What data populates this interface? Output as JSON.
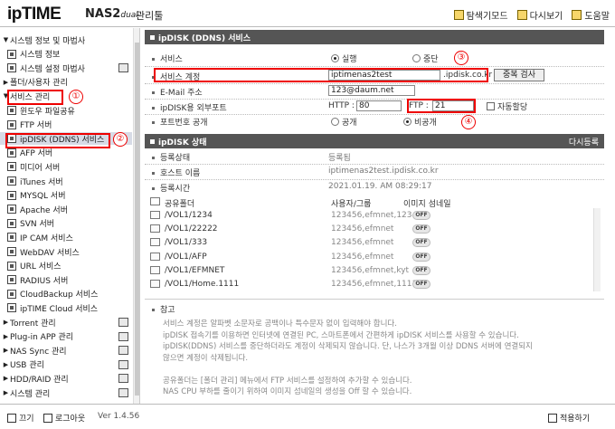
{
  "header": {
    "logo": "ipTIME",
    "model": "NAS2",
    "model_suffix": "dual",
    "manager": "관리툴",
    "buttons": [
      {
        "label": "탐색기모드",
        "icon": "explorer-icon"
      },
      {
        "label": "다시보기",
        "icon": "refresh-icon"
      },
      {
        "label": "도움말",
        "icon": "help-icon"
      }
    ]
  },
  "sidebar": {
    "items": [
      {
        "label": "시스템 정보 및 마법사",
        "level": 0,
        "arrow": "▼",
        "icon": ""
      },
      {
        "label": "시스템 정보",
        "level": 1,
        "icon": "system-info-icon"
      },
      {
        "label": "시스템 설정 마법사",
        "level": 1,
        "icon": "wizard-icon",
        "right": true
      },
      {
        "label": "폴더/사용자 관리",
        "level": 0,
        "arrow": "▶",
        "icon": ""
      },
      {
        "label": "서비스 관리",
        "level": 0,
        "arrow": "▼",
        "icon": ""
      },
      {
        "label": "윈도우 파일공유",
        "level": 1,
        "icon": "windows-share-icon"
      },
      {
        "label": "FTP 서버",
        "level": 1,
        "icon": "ftp-icon"
      },
      {
        "label": "ipDISK (DDNS) 서비스",
        "level": 1,
        "icon": "ipdisk-icon",
        "selected": true
      },
      {
        "label": "AFP 서버",
        "level": 1,
        "icon": "afp-icon"
      },
      {
        "label": "미디어 서버",
        "level": 1,
        "icon": "media-icon"
      },
      {
        "label": "iTunes 서버",
        "level": 1,
        "icon": "itunes-icon"
      },
      {
        "label": "MYSQL 서버",
        "level": 1,
        "icon": "mysql-icon"
      },
      {
        "label": "Apache 서버",
        "level": 1,
        "icon": "apache-icon"
      },
      {
        "label": "SVN 서버",
        "level": 1,
        "icon": "svn-icon"
      },
      {
        "label": "IP CAM 서비스",
        "level": 1,
        "icon": "ipcam-icon"
      },
      {
        "label": "WebDAV 서비스",
        "level": 1,
        "icon": "webdav-icon"
      },
      {
        "label": "URL 서비스",
        "level": 1,
        "icon": "url-icon"
      },
      {
        "label": "RADIUS 서버",
        "level": 1,
        "icon": "radius-icon"
      },
      {
        "label": "CloudBackup 서비스",
        "level": 1,
        "icon": "cloudbackup-icon"
      },
      {
        "label": "ipTIME Cloud 서비스",
        "level": 1,
        "icon": "cloud-icon"
      },
      {
        "label": "Torrent 관리",
        "level": 0,
        "arrow": "▶",
        "icon": "",
        "right": true
      },
      {
        "label": "Plug-in APP 관리",
        "level": 0,
        "arrow": "▶",
        "icon": "",
        "right": true
      },
      {
        "label": "NAS Sync 관리",
        "level": 0,
        "arrow": "▶",
        "icon": "",
        "right": true
      },
      {
        "label": "USB 관리",
        "level": 0,
        "arrow": "▶",
        "icon": "",
        "right": true
      },
      {
        "label": "HDD/RAID 관리",
        "level": 0,
        "arrow": "▶",
        "icon": "",
        "right": true
      },
      {
        "label": "시스템 관리",
        "level": 0,
        "arrow": "▶",
        "icon": "",
        "right": true
      }
    ]
  },
  "footer": {
    "exit": "끄기",
    "logout": "로그아웃",
    "version": "Ver 1.4.56",
    "apply": "적용하기"
  },
  "ipdisk_service": {
    "title": "ipDISK (DDNS) 서비스",
    "service_label": "서비스",
    "run_label": "실행",
    "stop_label": "중단",
    "account_label": "서비스 계정",
    "account_value": "iptimenas2test",
    "domain_suffix": ".ipdisk.co.kr",
    "dup_check": "중복 검사",
    "email_label": "E-Mail 주소",
    "email_value": "123@daum.net",
    "ext_port_label": "ipDISK용 외부포트",
    "http_label": "HTTP :",
    "http_value": "80",
    "ftp_label": "FTP :",
    "ftp_value": "21",
    "auto_assign": "자동할당",
    "port_public_label": "포트번호 공개",
    "public": "공개",
    "private": "비공개"
  },
  "ipdisk_status": {
    "title": "ipDISK 상태",
    "reregister": "다시등록",
    "rows": [
      {
        "label": "등록상태",
        "value": "등록됨"
      },
      {
        "label": "호스트 이름",
        "value": "iptimenas2test.ipdisk.co.kr"
      },
      {
        "label": "등록시간",
        "value": "2021.01.19. AM 08:29:17"
      }
    ]
  },
  "shares": {
    "col_folder": "공유폴더",
    "col_users": "사용자/그룹",
    "col_thumb": "이미지 섬네일",
    "toggle_label": "OFF",
    "rows": [
      {
        "path": "/VOL1/1234",
        "users": "123456,efmnet,1234"
      },
      {
        "path": "/VOL1/22222",
        "users": "123456,efmnet"
      },
      {
        "path": "/VOL1/333",
        "users": "123456,efmnet"
      },
      {
        "path": "/VOL1/AFP",
        "users": "123456,efmnet"
      },
      {
        "path": "/VOL1/EFMNET",
        "users": "123456,efmnet,kyt"
      },
      {
        "path": "/VOL1/Home.1111",
        "users": "123456,efmnet,1111"
      }
    ]
  },
  "notes": {
    "title": "참고",
    "lines": [
      "서비스 계정은 알파벳 소문자로 공백이나 특수문자 없이 입력해야 합니다.",
      "ipDISK 접속기를 이용하면 인터넷에 연결된 PC, 스마트폰에서 간편하게 ipDISK 서비스를 사용할 수 있습니다.",
      "ipDISK(DDNS) 서비스를 중단하더라도 계정이 삭제되지 않습니다. 단, 나스가 3개월 이상 DDNS 서버에 연결되지",
      "않으면 계정이 삭제됩니다.",
      "",
      "공유폴더는 [폴더 관리] 메뉴에서 FTP 서비스를 설정하여 추가할 수 있습니다.",
      "NAS CPU 부하를 줄이기 위하여 이미지 섬네일의 생성을 Off 할 수 있습니다."
    ]
  },
  "annotations": [
    "①",
    "②",
    "③",
    "④"
  ],
  "colors": {
    "highlight": "#e00000",
    "section_header": "#555555",
    "selected_row": "#d7dbe6"
  }
}
